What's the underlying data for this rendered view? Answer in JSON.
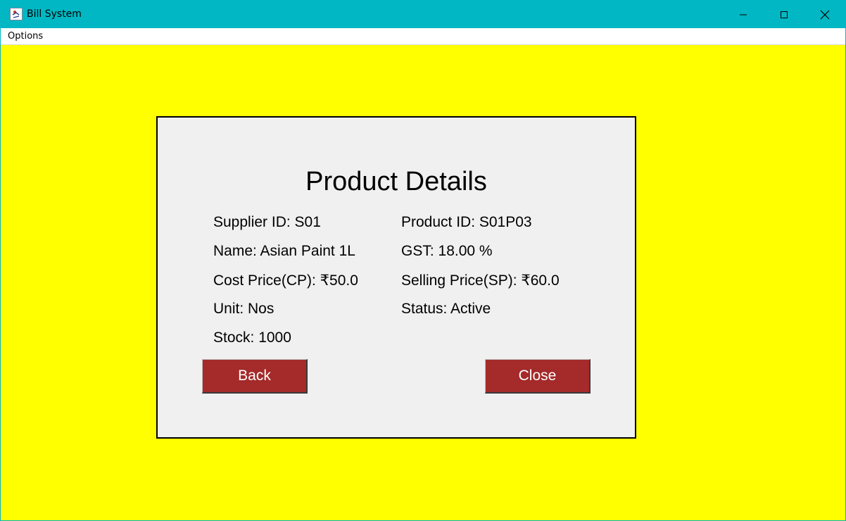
{
  "window": {
    "title": "Bill System",
    "titlebar_color": "#00b7c3",
    "background_color": "#ffff00"
  },
  "menu": {
    "items": [
      "Options"
    ]
  },
  "panel": {
    "title": "Product Details",
    "background_color": "#f0f0f0",
    "fields": {
      "supplier_id": "Supplier ID: S01",
      "product_id": "Product ID: S01P03",
      "name": "Name: Asian Paint 1L",
      "gst": "GST: 18.00 %",
      "cost_price": "Cost Price(CP): ₹50.0",
      "selling_price": "Selling Price(SP): ₹60.0",
      "unit": "Unit: Nos",
      "status": "Status: Active",
      "stock": "Stock: 1000"
    },
    "buttons": {
      "back": "Back",
      "close": "Close",
      "color": "#a52a2a"
    }
  },
  "icons": [
    "app-icon",
    "minimize-icon",
    "maximize-icon",
    "close-icon"
  ]
}
